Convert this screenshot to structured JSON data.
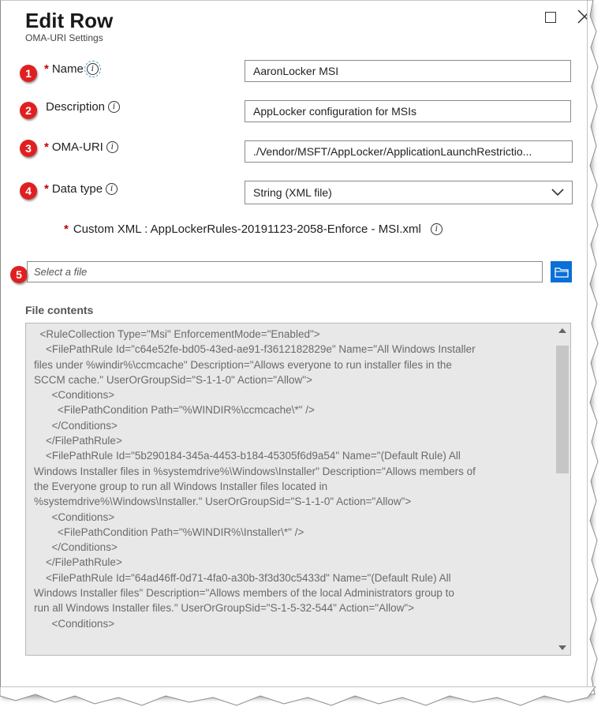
{
  "header": {
    "title": "Edit Row",
    "subtitle": "OMA-URI Settings"
  },
  "badges": [
    "1",
    "2",
    "3",
    "4",
    "5"
  ],
  "fields": {
    "name": {
      "required_mark": "*",
      "label": "Name",
      "value": "AaronLocker MSI"
    },
    "description": {
      "label": "Description",
      "value": "AppLocker configuration for MSIs"
    },
    "oma_uri": {
      "required_mark": "*",
      "label": "OMA-URI",
      "value": "./Vendor/MSFT/AppLocker/ApplicationLaunchRestrictio..."
    },
    "data_type": {
      "required_mark": "*",
      "label": "Data type",
      "value": "String (XML file)"
    }
  },
  "custom_xml": {
    "required_mark": "*",
    "label": "Custom XML : AppLockerRules-20191123-2058-Enforce - MSI.xml"
  },
  "file_picker": {
    "placeholder": "Select a file"
  },
  "file_contents": {
    "label": "File contents",
    "text": "  <RuleCollection Type=\"Msi\" EnforcementMode=\"Enabled\">\n    <FilePathRule Id=\"c64e52fe-bd05-43ed-ae91-f3612182829e\" Name=\"All Windows Installer\nfiles under %windir%\\ccmcache\" Description=\"Allows everyone to run installer files in the\nSCCM cache.\" UserOrGroupSid=\"S-1-1-0\" Action=\"Allow\">\n      <Conditions>\n        <FilePathCondition Path=\"%WINDIR%\\ccmcache\\*\" />\n      </Conditions>\n    </FilePathRule>\n    <FilePathRule Id=\"5b290184-345a-4453-b184-45305f6d9a54\" Name=\"(Default Rule) All\nWindows Installer files in %systemdrive%\\Windows\\Installer\" Description=\"Allows members of\nthe Everyone group to run all Windows Installer files located in\n%systemdrive%\\Windows\\Installer.\" UserOrGroupSid=\"S-1-1-0\" Action=\"Allow\">\n      <Conditions>\n        <FilePathCondition Path=\"%WINDIR%\\Installer\\*\" />\n      </Conditions>\n    </FilePathRule>\n    <FilePathRule Id=\"64ad46ff-0d71-4fa0-a30b-3f3d30c5433d\" Name=\"(Default Rule) All\nWindows Installer files\" Description=\"Allows members of the local Administrators group to\nrun all Windows Installer files.\" UserOrGroupSid=\"S-1-5-32-544\" Action=\"Allow\">\n      <Conditions>"
  },
  "colors": {
    "badge": "#e02020",
    "required": "#c00000",
    "accent": "#0a6fd6"
  }
}
